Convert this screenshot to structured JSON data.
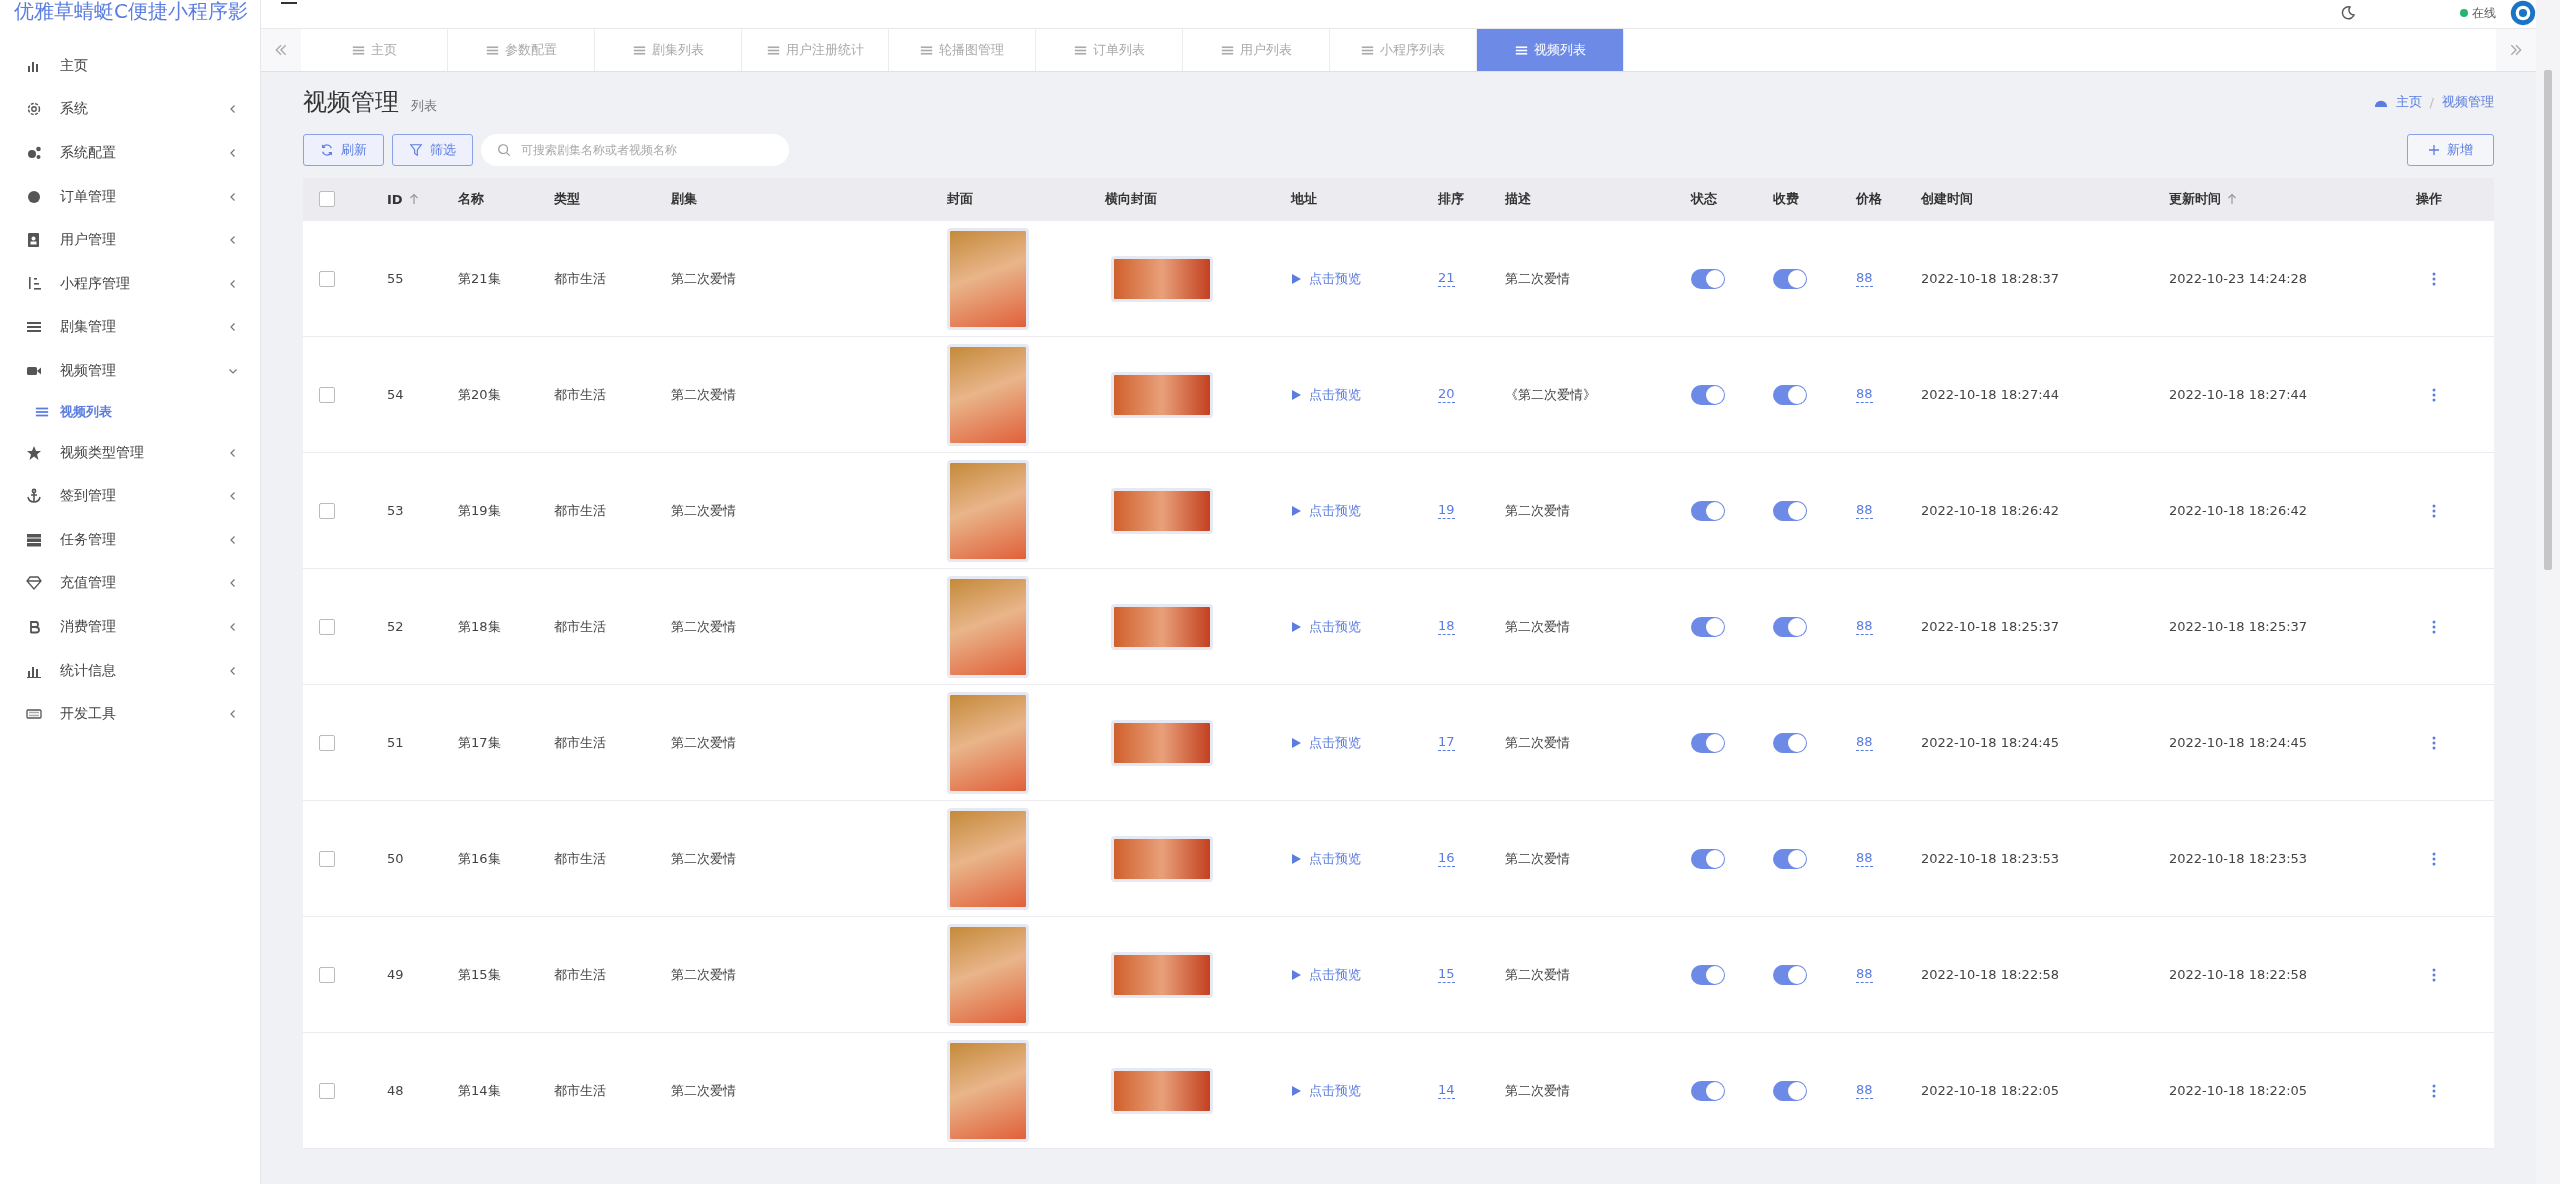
{
  "app_title": "优雅草蜻蜓C便捷小程序影",
  "header": {
    "status": "在线"
  },
  "sidebar": {
    "items": [
      {
        "label": "主页",
        "selected": false
      },
      {
        "label": "系统",
        "selected": false,
        "expanded": false
      },
      {
        "label": "系统配置",
        "selected": false,
        "expanded": false
      },
      {
        "label": "订单管理",
        "selected": false,
        "expanded": false
      },
      {
        "label": "用户管理",
        "selected": false,
        "expanded": false
      },
      {
        "label": "小程序管理",
        "selected": false,
        "expanded": false
      },
      {
        "label": "剧集管理",
        "selected": false,
        "expanded": false
      },
      {
        "label": "视频管理",
        "selected": false,
        "expanded": true,
        "children": [
          {
            "label": "视频列表",
            "selected": true
          }
        ]
      },
      {
        "label": "视频类型管理",
        "selected": false,
        "expanded": false
      },
      {
        "label": "签到管理",
        "selected": false,
        "expanded": false
      },
      {
        "label": "任务管理",
        "selected": false,
        "expanded": false
      },
      {
        "label": "充值管理",
        "selected": false,
        "expanded": false
      },
      {
        "label": "消费管理",
        "selected": false,
        "expanded": false
      },
      {
        "label": "统计信息",
        "selected": false,
        "expanded": false
      },
      {
        "label": "开发工具",
        "selected": false,
        "expanded": false
      }
    ]
  },
  "tabs": [
    {
      "label": "主页",
      "selected": false
    },
    {
      "label": "参数配置",
      "selected": false
    },
    {
      "label": "剧集列表",
      "selected": false
    },
    {
      "label": "用户注册统计",
      "selected": false
    },
    {
      "label": "轮播图管理",
      "selected": false
    },
    {
      "label": "订单列表",
      "selected": false
    },
    {
      "label": "用户列表",
      "selected": false
    },
    {
      "label": "小程序列表",
      "selected": false
    },
    {
      "label": "视频列表",
      "selected": true
    }
  ],
  "page": {
    "title": "视频管理",
    "subtitle": "列表",
    "breadcrumb": [
      "主页",
      "视频管理"
    ],
    "breadcrumb_separator": "/"
  },
  "toolbar": {
    "refresh": "刷新",
    "filter": "筛选",
    "search": {
      "placeholder": "可搜索剧集名称或者视频名称"
    },
    "add": "新增"
  },
  "table": {
    "columns": [
      "ID",
      "名称",
      "类型",
      "剧集",
      "封面",
      "横向封面",
      "地址",
      "排序",
      "描述",
      "状态",
      "收费",
      "价格",
      "创建时间",
      "更新时间",
      "操作"
    ],
    "select_all_checked": false,
    "rows": [
      {
        "checked": false,
        "id": "55",
        "name": "第21集",
        "type": "都市生活",
        "series": "第二次爱情",
        "preview": "点击预览",
        "sort": "21",
        "desc": "第二次爱情",
        "status": true,
        "fee": true,
        "price": "88",
        "created": "2022-10-18 18:28:37",
        "updated": "2022-10-23 14:24:28"
      },
      {
        "checked": false,
        "id": "54",
        "name": "第20集",
        "type": "都市生活",
        "series": "第二次爱情",
        "preview": "点击预览",
        "sort": "20",
        "desc": "《第二次爱情》",
        "status": true,
        "fee": true,
        "price": "88",
        "created": "2022-10-18 18:27:44",
        "updated": "2022-10-18 18:27:44"
      },
      {
        "checked": false,
        "id": "53",
        "name": "第19集",
        "type": "都市生活",
        "series": "第二次爱情",
        "preview": "点击预览",
        "sort": "19",
        "desc": "第二次爱情",
        "status": true,
        "fee": true,
        "price": "88",
        "created": "2022-10-18 18:26:42",
        "updated": "2022-10-18 18:26:42"
      },
      {
        "checked": false,
        "id": "52",
        "name": "第18集",
        "type": "都市生活",
        "series": "第二次爱情",
        "preview": "点击预览",
        "sort": "18",
        "desc": "第二次爱情",
        "status": true,
        "fee": true,
        "price": "88",
        "created": "2022-10-18 18:25:37",
        "updated": "2022-10-18 18:25:37"
      },
      {
        "checked": false,
        "id": "51",
        "name": "第17集",
        "type": "都市生活",
        "series": "第二次爱情",
        "preview": "点击预览",
        "sort": "17",
        "desc": "第二次爱情",
        "status": true,
        "fee": true,
        "price": "88",
        "created": "2022-10-18 18:24:45",
        "updated": "2022-10-18 18:24:45"
      },
      {
        "checked": false,
        "id": "50",
        "name": "第16集",
        "type": "都市生活",
        "series": "第二次爱情",
        "preview": "点击预览",
        "sort": "16",
        "desc": "第二次爱情",
        "status": true,
        "fee": true,
        "price": "88",
        "created": "2022-10-18 18:23:53",
        "updated": "2022-10-18 18:23:53"
      },
      {
        "checked": false,
        "id": "49",
        "name": "第15集",
        "type": "都市生活",
        "series": "第二次爱情",
        "preview": "点击预览",
        "sort": "15",
        "desc": "第二次爱情",
        "status": true,
        "fee": true,
        "price": "88",
        "created": "2022-10-18 18:22:58",
        "updated": "2022-10-18 18:22:58"
      },
      {
        "checked": false,
        "id": "48",
        "name": "第14集",
        "type": "都市生活",
        "series": "第二次爱情",
        "preview": "点击预览",
        "sort": "14",
        "desc": "第二次爱情",
        "status": true,
        "fee": true,
        "price": "88",
        "created": "2022-10-18 18:22:05",
        "updated": "2022-10-18 18:22:05"
      }
    ]
  }
}
